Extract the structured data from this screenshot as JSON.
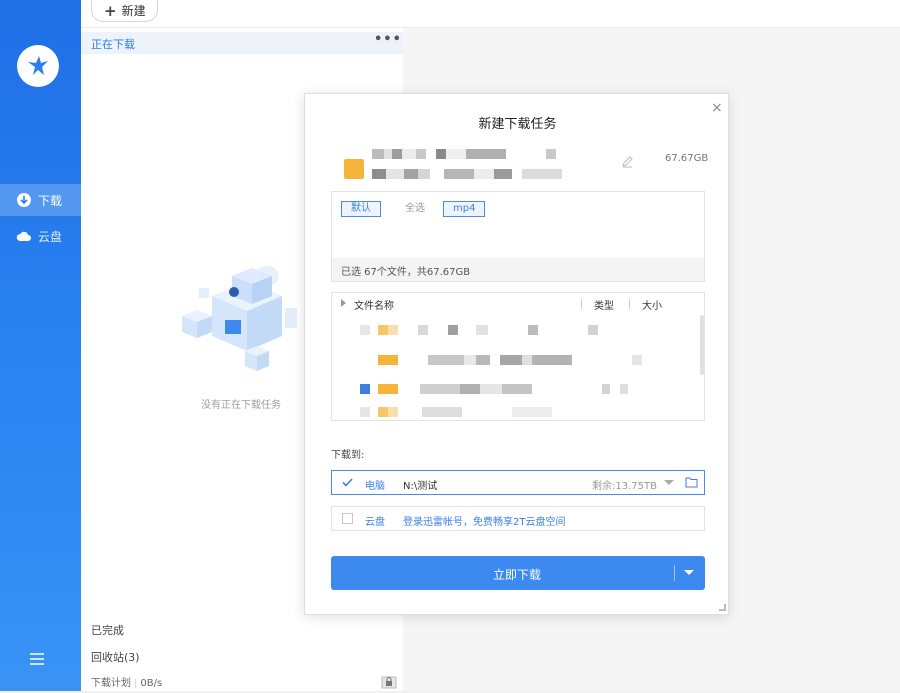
{
  "toolbar": {
    "new_label": "新建"
  },
  "sidebar": {
    "items": [
      {
        "label": "下载",
        "icon": "download-icon",
        "active": true
      },
      {
        "label": "云盘",
        "icon": "cloud-icon",
        "active": false
      }
    ]
  },
  "task_list": {
    "section_title": "正在下载",
    "more_label": "•••",
    "empty_text": "没有正在下载任务",
    "completed_label": "已完成",
    "recycle_label": "回收站(3)",
    "schedule_label": "下载计划",
    "speed": "0B/s"
  },
  "dialog": {
    "title": "新建下载任务",
    "close": "×",
    "total_size": "67.67GB",
    "filters": {
      "default": "默认",
      "select_all": "全选",
      "mp4": "mp4"
    },
    "summary": "已选 67个文件，共67.67GB",
    "columns": {
      "name": "文件名称",
      "type": "类型",
      "size": "大小"
    },
    "save_to_label": "下载到:",
    "destinations": {
      "pc": {
        "name": "电脑",
        "path": "N:\\测试",
        "free": "剩余:13.75TB"
      },
      "cloud": {
        "name": "云盘",
        "hint": "登录迅雷帐号，免费畅享2T云盘空间"
      }
    },
    "download_button": "立即下载"
  },
  "colors": {
    "accent": "#3c8af0",
    "sidebar": "#2a7ff0",
    "folder": "#f7b43a"
  }
}
